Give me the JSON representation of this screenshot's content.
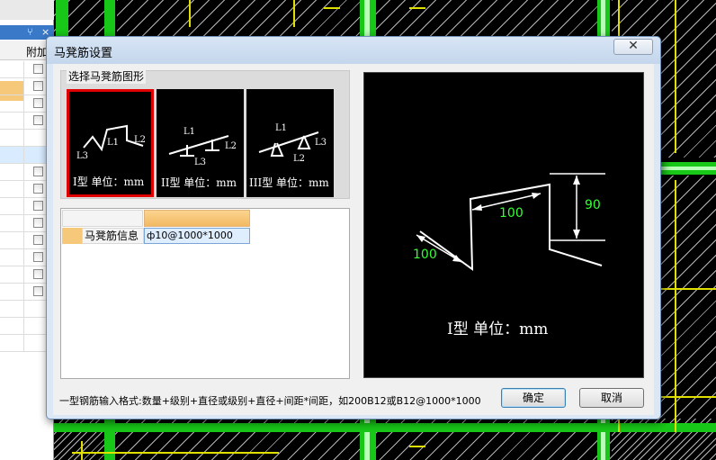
{
  "left_panel": {
    "pin_glyph": "⑂",
    "close_glyph": "×",
    "column_header": "附加",
    "row_count": 17
  },
  "dialog": {
    "title": "马凳筋设置",
    "close_glyph": "✕",
    "group_label": "选择马凳筋图形",
    "shapes": [
      {
        "id": "I",
        "caption": "I型 单位：mm",
        "labels": [
          "L1",
          "L2",
          "L3"
        ],
        "selected": true
      },
      {
        "id": "II",
        "caption": "II型 单位：mm",
        "labels": [
          "L1",
          "L2",
          "L3"
        ],
        "selected": false
      },
      {
        "id": "III",
        "caption": "III型 单位：mm",
        "labels": [
          "L1",
          "L2",
          "L3"
        ],
        "selected": false
      }
    ],
    "grid": {
      "row_label": "马凳筋信息",
      "row_value": "ф10@1000*1000"
    },
    "preview": {
      "dim_vertical": "90",
      "dim_top": "100",
      "dim_left": "100",
      "caption": "I型 单位：mm"
    },
    "hint": "一型钢筋输入格式:数量+级别+直径或级别+直径+间距*间距，如200B12或B12@1000*1000",
    "ok_label": "确定",
    "cancel_label": "取消"
  },
  "colors": {
    "accent_red": "#e00000",
    "dimension_green": "#33ff33",
    "beam_green": "#18c818",
    "cad_yellow": "#e0e000"
  }
}
